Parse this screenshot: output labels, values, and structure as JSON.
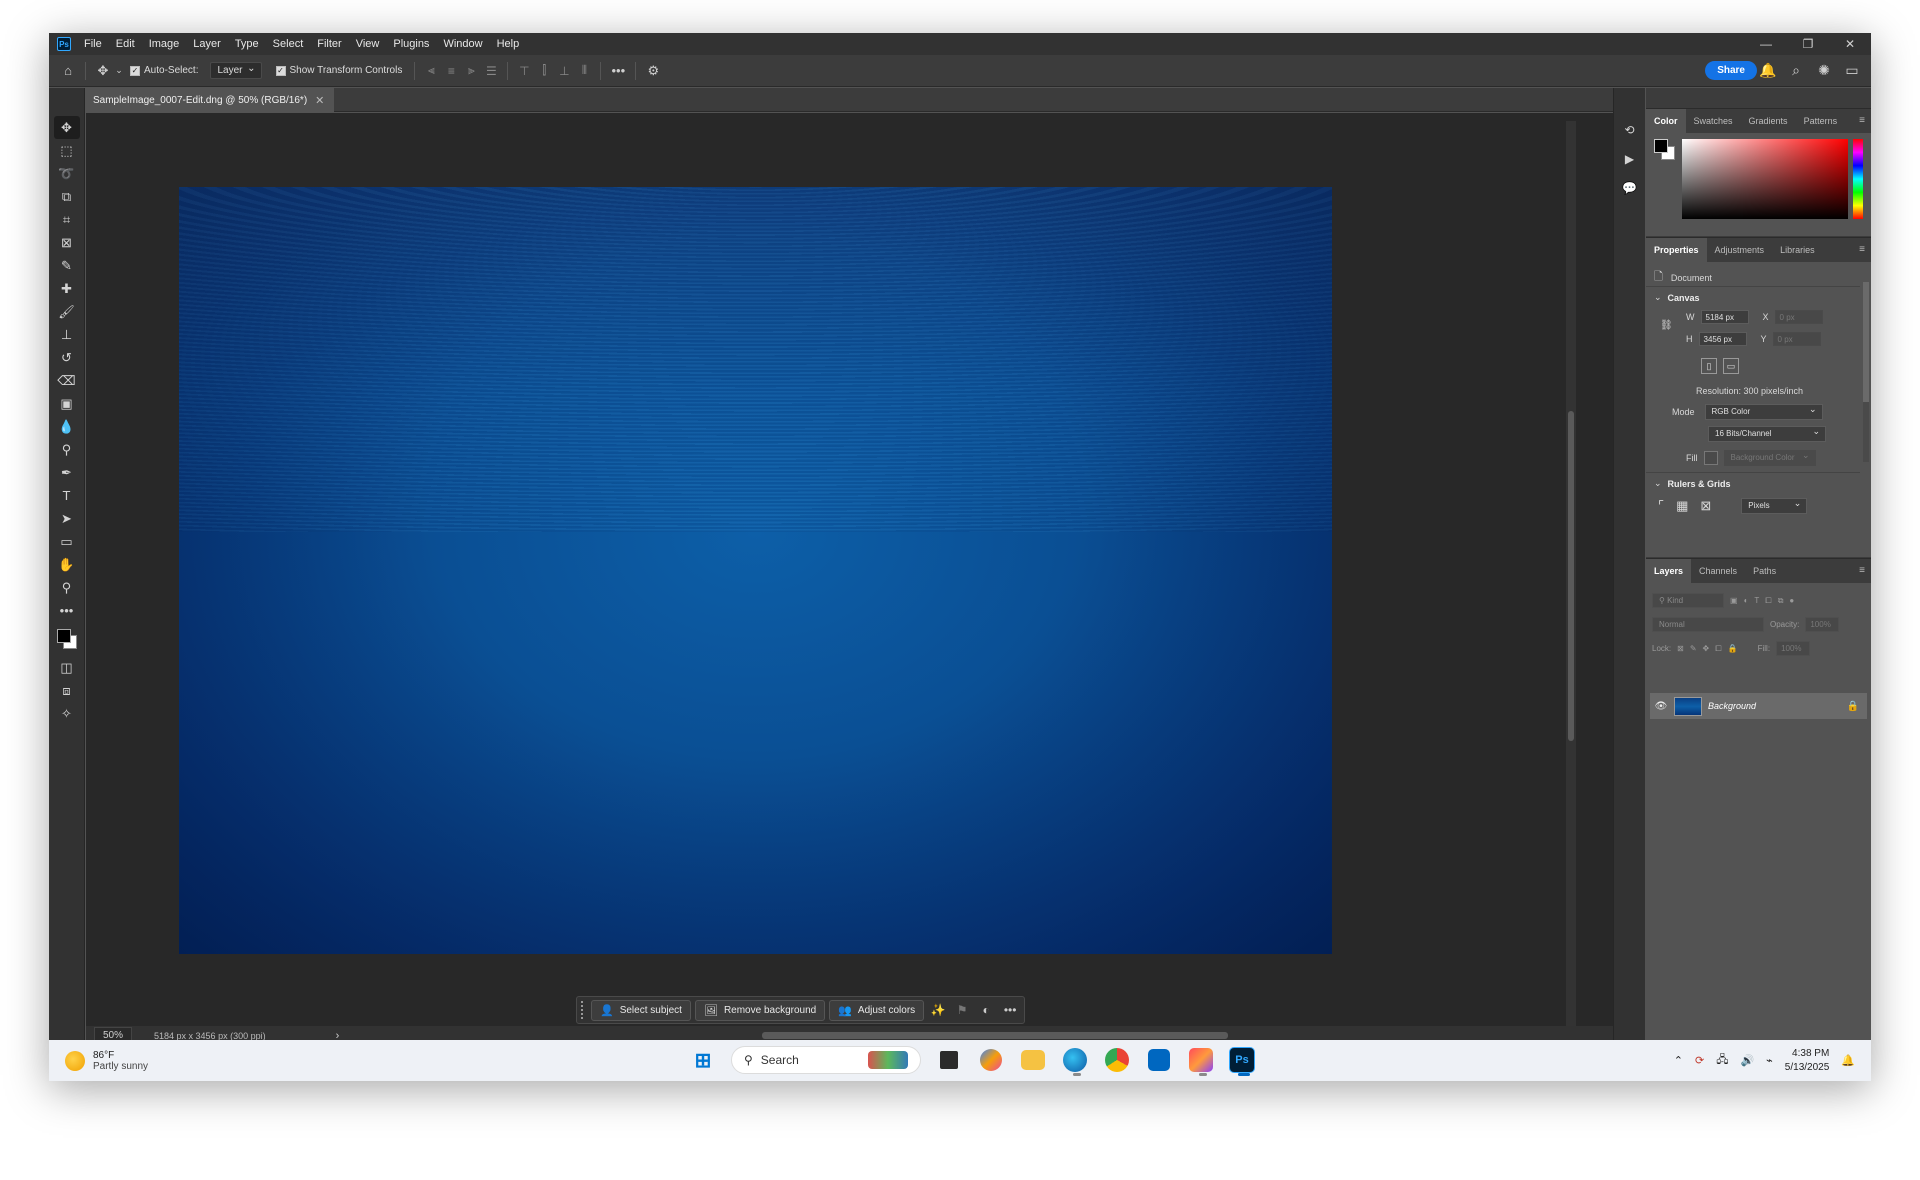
{
  "app": {
    "logo": "Ps",
    "menu": [
      "File",
      "Edit",
      "Image",
      "Layer",
      "Type",
      "Select",
      "Filter",
      "View",
      "Plugins",
      "Window",
      "Help"
    ]
  },
  "options_bar": {
    "auto_select_label": "Auto-Select:",
    "auto_select_value": "Layer",
    "show_transform_label": "Show Transform Controls",
    "more_label": "•••",
    "share_label": "Share"
  },
  "document": {
    "tab_title": "SampleImage_0007-Edit.dng @ 50% (RGB/16*)",
    "zoom": "50%",
    "dims_status": "5184 px x 3456 px (300 ppi)"
  },
  "context_bar": {
    "select_subject": "Select subject",
    "remove_background": "Remove background",
    "adjust_colors": "Adjust colors",
    "more": "•••"
  },
  "panels": {
    "color_tabs": [
      "Color",
      "Swatches",
      "Gradients",
      "Patterns"
    ],
    "properties_tabs": [
      "Properties",
      "Adjustments",
      "Libraries"
    ],
    "document_label": "Document",
    "canvas": {
      "header": "Canvas",
      "w_label": "W",
      "w_value": "5184 px",
      "h_label": "H",
      "h_value": "3456 px",
      "x_label": "X",
      "x_value": "0 px",
      "y_label": "Y",
      "y_value": "0 px",
      "resolution": "Resolution: 300 pixels/inch",
      "mode_label": "Mode",
      "mode_value": "RGB Color",
      "depth_value": "16 Bits/Channel",
      "fill_label": "Fill",
      "fill_value": "Background Color"
    },
    "rulers": {
      "header": "Rulers & Grids",
      "units": "Pixels"
    },
    "layers_tabs": [
      "Layers",
      "Channels",
      "Paths"
    ],
    "layers": {
      "kind_placeholder": "Kind",
      "blend_mode": "Normal",
      "opacity_label": "Opacity:",
      "opacity_value": "100%",
      "lock_label": "Lock:",
      "fill_label": "Fill:",
      "fill_value": "100%",
      "layer_name": "Background"
    }
  },
  "taskbar": {
    "weather_temp": "86°F",
    "weather_desc": "Partly sunny",
    "search_placeholder": "Search",
    "time": "4:38 PM",
    "date": "5/13/2025"
  },
  "colors": {
    "accent": "#1473e6",
    "image_blue": "#0a4e93",
    "panel_bg": "#535353"
  }
}
